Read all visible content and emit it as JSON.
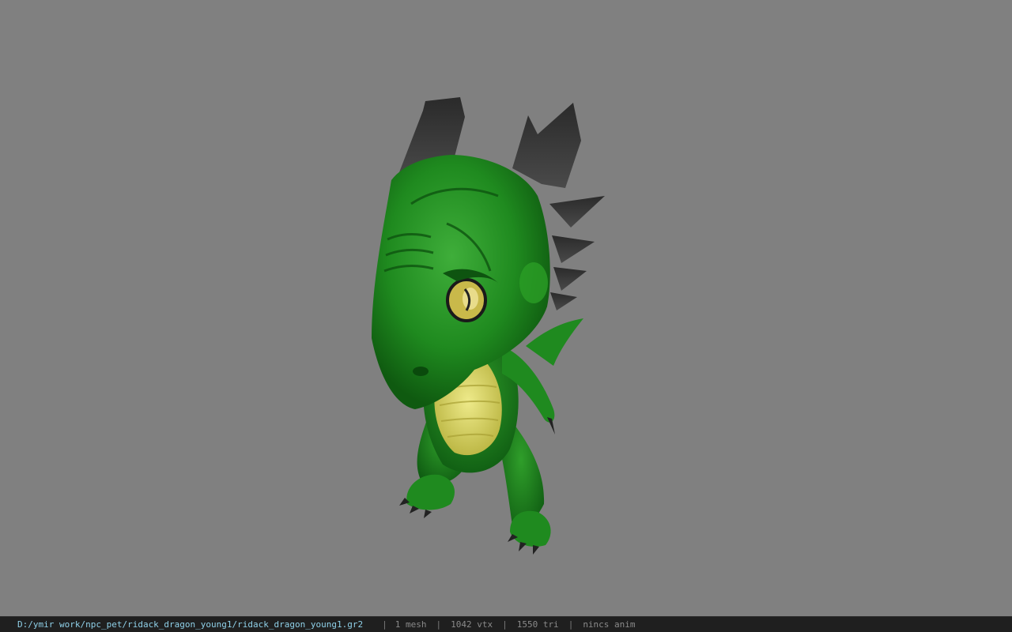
{
  "viewer": {
    "background_color": "#808080",
    "model_icon": "green-baby-dragon-model"
  },
  "status_bar": {
    "file_path": "D:/ymir work/npc_pet/ridack_dragon_young1/ridack_dragon_young1.gr2",
    "separator": "|",
    "mesh_count": "1 mesh",
    "vertex_count": "1042 vtx",
    "triangle_count": "1550 tri",
    "animation": "nincs anim",
    "path_color": "#8fd0e8"
  }
}
